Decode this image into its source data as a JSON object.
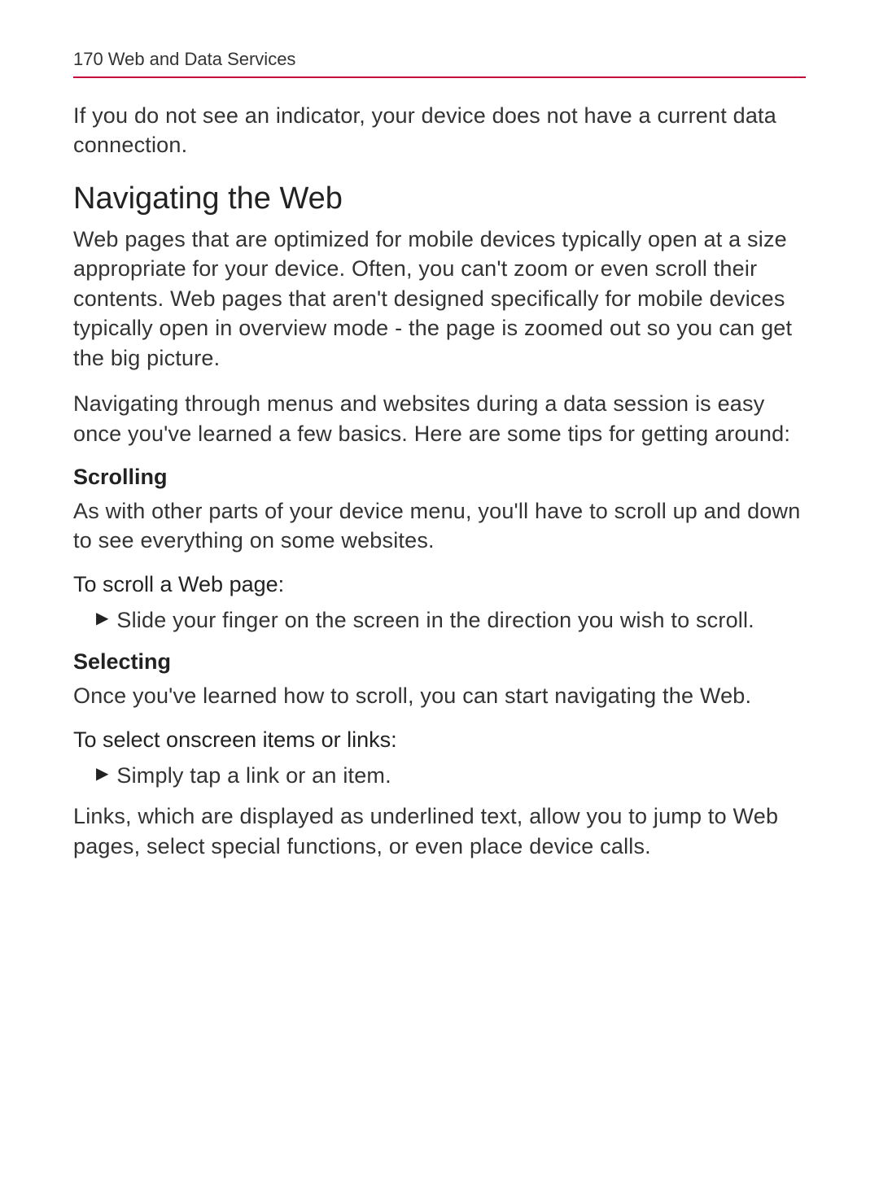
{
  "header": {
    "page_number": "170",
    "section_title": "Web and Data Services"
  },
  "intro": "If you do not see an indicator, your device does not have a current data connection.",
  "heading": "Navigating the Web",
  "para1": "Web pages that are optimized for mobile devices typically open at a size appropriate for your device. Often, you can't zoom or even scroll their contents. Web pages that aren't designed specifically for mobile devices typically open in overview mode - the page is zoomed out so you can get the big picture.",
  "para2": "Navigating through menus and websites during a data session is easy once you've learned a few basics. Here are some tips for getting around:",
  "scrolling": {
    "title": "Scrolling",
    "para": "As with other parts of your device menu, you'll have to scroll up and down to see everything on some websites.",
    "instr_title": "To scroll a Web page:",
    "bullet": "Slide your finger on the screen in the direction you wish to scroll."
  },
  "selecting": {
    "title": "Selecting",
    "para": "Once you've learned how to scroll, you can start navigating the Web.",
    "instr_title": "To select onscreen items or links:",
    "bullet": "Simply tap a link or an item.",
    "after": "Links, which are displayed as underlined text, allow you to jump to Web pages, select special functions, or even place device calls."
  }
}
